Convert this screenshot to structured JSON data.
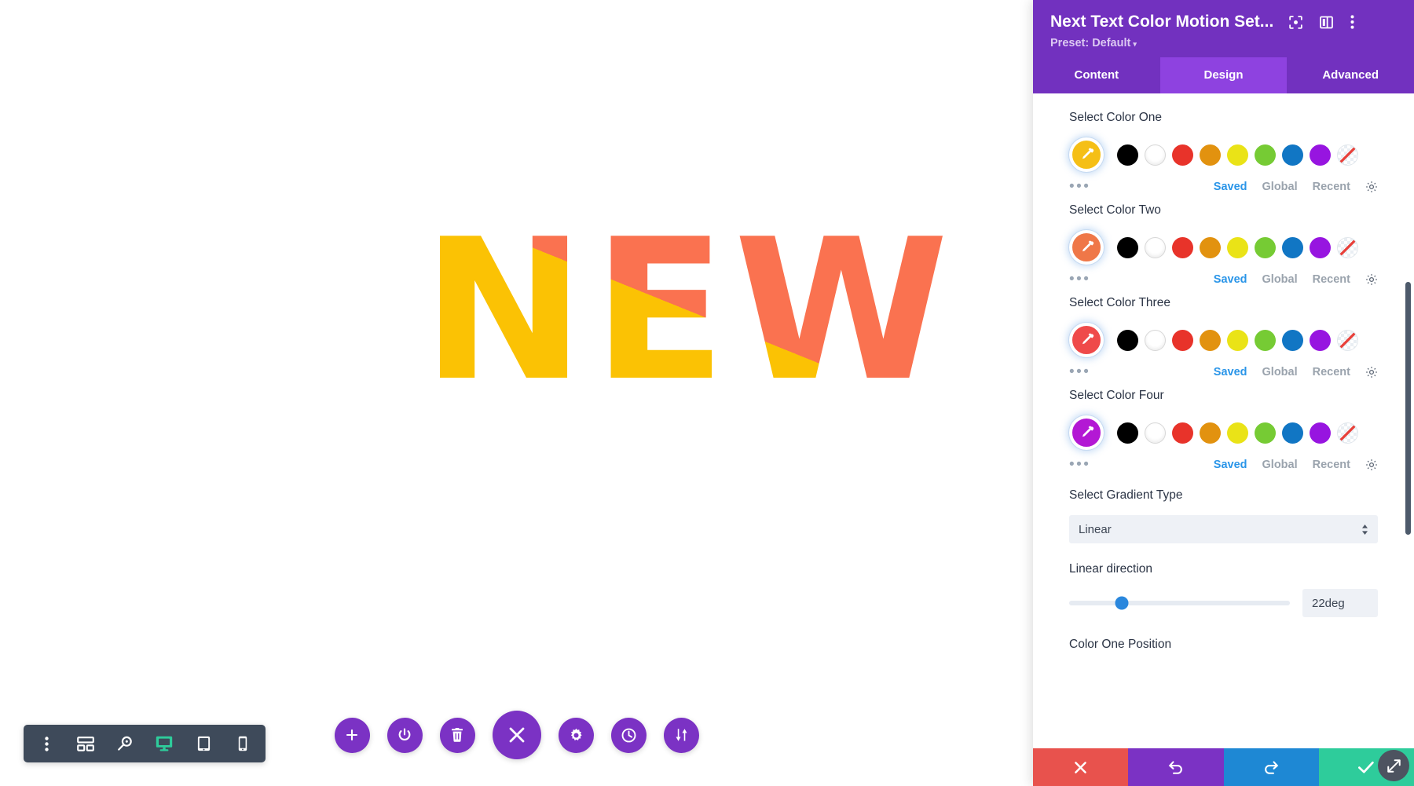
{
  "canvas": {
    "hero_text": "NEW",
    "hero_gradient": {
      "angle_deg": 22,
      "color_one": "#fbc204",
      "color_two": "#fa7250",
      "color_one_stop_pct": 50,
      "color_two_stop_pct": 50
    }
  },
  "mode_toolbar": {
    "items": [
      {
        "name": "more-options-icon",
        "label": "More options"
      },
      {
        "name": "wireframe-icon",
        "label": "Wireframe view"
      },
      {
        "name": "zoom-icon",
        "label": "Zoom"
      },
      {
        "name": "desktop-icon",
        "label": "Desktop view",
        "active": true
      },
      {
        "name": "tablet-icon",
        "label": "Tablet view"
      },
      {
        "name": "phone-icon",
        "label": "Phone view"
      }
    ]
  },
  "fab_row": {
    "items": [
      {
        "name": "add-icon",
        "label": "Add"
      },
      {
        "name": "power-icon",
        "label": "Toggle builder"
      },
      {
        "name": "trash-icon",
        "label": "Delete"
      },
      {
        "name": "close-icon",
        "label": "Close",
        "big": true
      },
      {
        "name": "gear-icon",
        "label": "Settings"
      },
      {
        "name": "history-icon",
        "label": "Editing history"
      },
      {
        "name": "sort-icon",
        "label": "Reorder"
      }
    ]
  },
  "panel": {
    "title": "Next Text Color Motion Set...",
    "preset_label": "Preset: Default",
    "preset_caret": "▾",
    "header_icons": [
      {
        "name": "focus-icon",
        "label": "Focus"
      },
      {
        "name": "layout-icon",
        "label": "Layout"
      },
      {
        "name": "kebab-menu-icon",
        "label": "More"
      }
    ],
    "tabs": [
      {
        "label": "Content",
        "active": false
      },
      {
        "label": "Design",
        "active": true
      },
      {
        "label": "Advanced",
        "active": false
      }
    ],
    "swatch_palette": [
      {
        "name": "black",
        "hex": "#000000"
      },
      {
        "name": "white",
        "hex": "#ffffff"
      },
      {
        "name": "red",
        "hex": "#e8332a"
      },
      {
        "name": "orange",
        "hex": "#e2920f"
      },
      {
        "name": "yellow",
        "hex": "#eae317"
      },
      {
        "name": "green",
        "hex": "#76cb34"
      },
      {
        "name": "blue",
        "hex": "#1176c4"
      },
      {
        "name": "purple",
        "hex": "#9715e0"
      },
      {
        "name": "none",
        "hex": "transparent"
      }
    ],
    "meta_links": [
      {
        "label": "Saved",
        "active": true
      },
      {
        "label": "Global",
        "active": false
      },
      {
        "label": "Recent",
        "active": false
      }
    ],
    "color_fields": [
      {
        "label": "Select Color One",
        "value_hex": "#f5bf16"
      },
      {
        "label": "Select Color Two",
        "value_hex": "#ef7748"
      },
      {
        "label": "Select Color Three",
        "value_hex": "#ef4a4a"
      },
      {
        "label": "Select Color Four",
        "value_hex": "#b318d4"
      }
    ],
    "gradient_type": {
      "label": "Select Gradient Type",
      "value": "Linear"
    },
    "linear_direction": {
      "label": "Linear direction",
      "value": "22deg",
      "thumb_pct": 24
    },
    "color_one_position": {
      "label": "Color One Position"
    },
    "actions": [
      {
        "name": "cancel-button",
        "icon": "close-icon",
        "color": "#e8524d"
      },
      {
        "name": "undo-button",
        "icon": "undo-icon",
        "color": "#7b32c4"
      },
      {
        "name": "redo-button",
        "icon": "redo-icon",
        "color": "#1e88d4"
      },
      {
        "name": "save-button",
        "icon": "check-icon",
        "color": "#2ecc9b"
      }
    ],
    "resize_handle": {
      "name": "resize-handle",
      "label": "Resize panel"
    }
  }
}
